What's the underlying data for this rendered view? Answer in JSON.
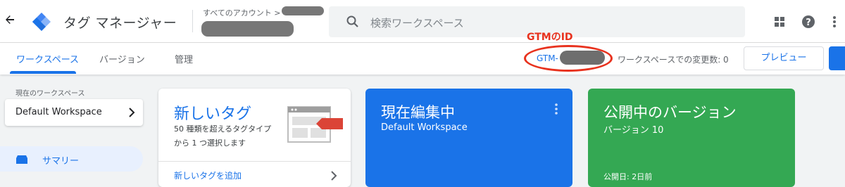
{
  "header": {
    "app_title": "タグ マネージャー",
    "account_label": "すべてのアカウント >",
    "search_placeholder": "検索ワークスペース"
  },
  "subnav": {
    "tabs": [
      {
        "label": "ワークスペース",
        "active": true
      },
      {
        "label": "バージョン",
        "active": false
      },
      {
        "label": "管理",
        "active": false
      }
    ],
    "container_id_prefix": "GTM-",
    "annotation_label": "GTMのID",
    "changes_text": "ワークスペースでの変更数: 0",
    "preview_label": "プレビュー"
  },
  "sidebar": {
    "workspace_label": "現在のワークスペース",
    "workspace_name": "Default Workspace",
    "items": [
      {
        "label": "サマリー",
        "icon": "summary-icon",
        "active": true
      }
    ]
  },
  "cards": {
    "new_tag": {
      "title": "新しいタグ",
      "description": "50 種類を超えるタグタイプから 1 つ選択します",
      "link": "新しいタグを追加"
    },
    "editing": {
      "title": "現在編集中",
      "subtitle": "Default Workspace"
    },
    "published": {
      "title": "公開中のバージョン",
      "subtitle": "バージョン 10",
      "date": "公開日: 2日前"
    }
  },
  "colors": {
    "accent": "#1a73e8",
    "green": "#34a853",
    "annotation": "#e8321e"
  }
}
